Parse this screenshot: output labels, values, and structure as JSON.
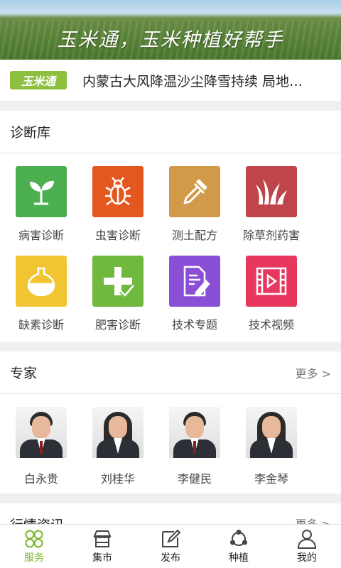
{
  "banner": {
    "slogan": "玉米通，玉米种植好帮手"
  },
  "news": {
    "badge": "玉米通",
    "headline": "内蒙古大风降温沙尘降雪持续 局地…"
  },
  "diagnosis": {
    "title": "诊断库",
    "items": [
      {
        "label": "病害诊断",
        "icon": "seedling-icon",
        "color": "#4caf50"
      },
      {
        "label": "虫害诊断",
        "icon": "bug-icon",
        "color": "#e4571f"
      },
      {
        "label": "测土配方",
        "icon": "dropper-icon",
        "color": "#d19a48"
      },
      {
        "label": "除草剂药害",
        "icon": "grass-icon",
        "color": "#c0454a"
      },
      {
        "label": "缺素诊断",
        "icon": "flask-icon",
        "color": "#f0c531"
      },
      {
        "label": "肥害诊断",
        "icon": "plus-icon",
        "color": "#71b83f"
      },
      {
        "label": "技术专题",
        "icon": "document-icon",
        "color": "#8a4fd6"
      },
      {
        "label": "技术视频",
        "icon": "video-icon",
        "color": "#e8375f"
      }
    ]
  },
  "experts": {
    "title": "专家",
    "more": "更多 >",
    "people": [
      {
        "name": "白永贵"
      },
      {
        "name": "刘桂华"
      },
      {
        "name": "李健民"
      },
      {
        "name": "李金琴"
      }
    ]
  },
  "market_news": {
    "title": "行情资讯",
    "more": "更多 >"
  },
  "tabbar": {
    "items": [
      {
        "label": "服务",
        "icon": "clover-icon",
        "active": true
      },
      {
        "label": "集市",
        "icon": "store-icon",
        "active": false
      },
      {
        "label": "发布",
        "icon": "edit-icon",
        "active": false
      },
      {
        "label": "种植",
        "icon": "share-icon",
        "active": false
      },
      {
        "label": "我的",
        "icon": "user-icon",
        "active": false
      }
    ]
  },
  "colors": {
    "brand_green": "#78b82a",
    "badge_green": "#8dc03f"
  }
}
